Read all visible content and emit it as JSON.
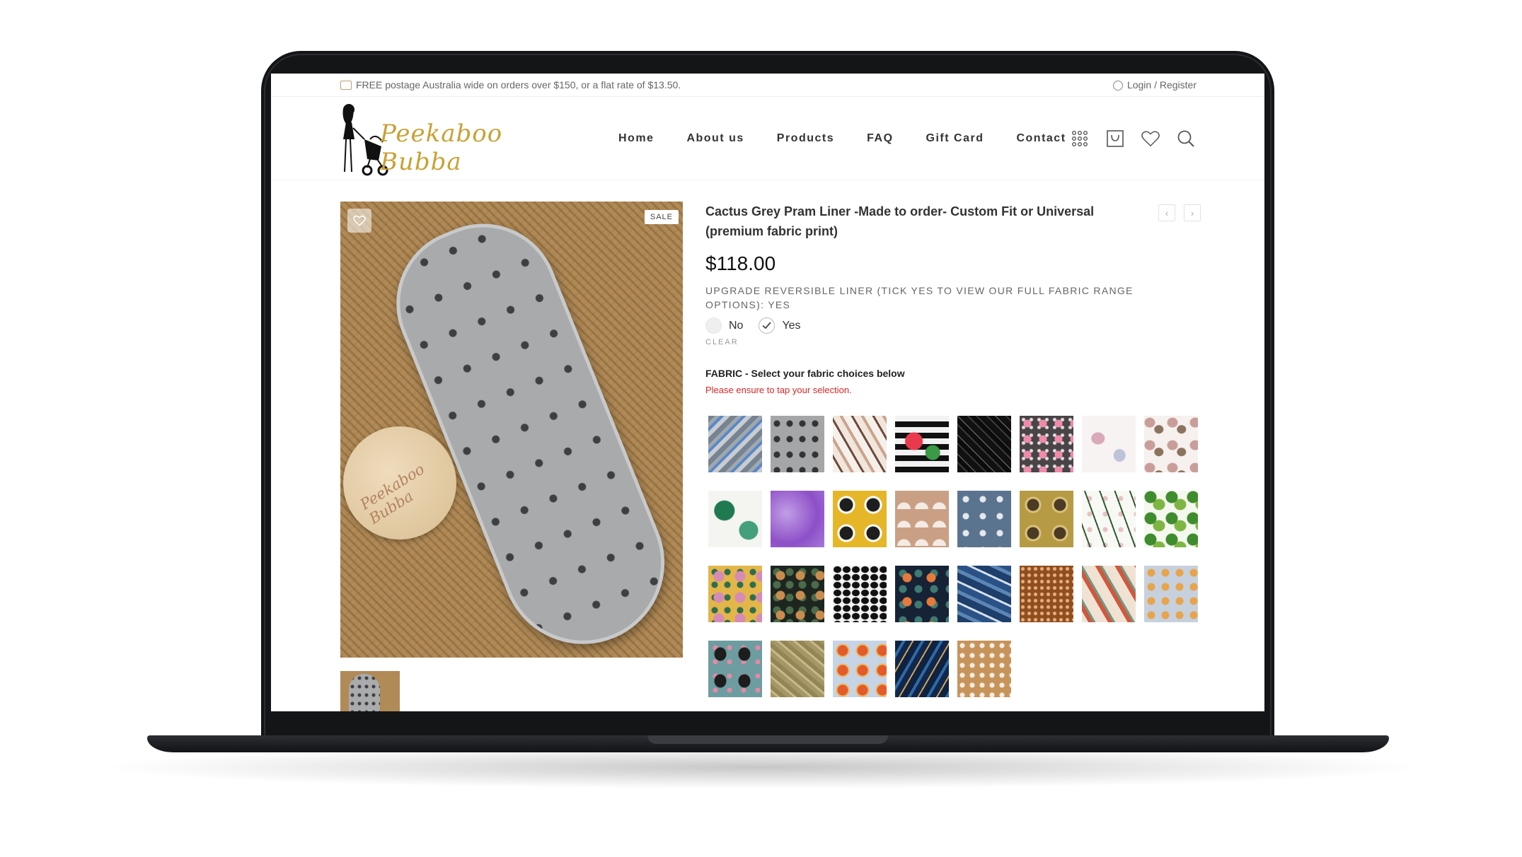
{
  "topbar": {
    "promo_text": "FREE postage Australia wide on orders over $150, or a flat rate of $13.50.",
    "account_text": "Login / Register"
  },
  "brand": {
    "logo_text": "Peekaboo Bubba",
    "gold_color": "#c9a134"
  },
  "nav": {
    "items": [
      {
        "label": "Home"
      },
      {
        "label": "About us"
      },
      {
        "label": "Products"
      },
      {
        "label": "FAQ"
      },
      {
        "label": "Gift Card"
      },
      {
        "label": "Contact"
      }
    ]
  },
  "header_icons": [
    "grid-icon",
    "cart-icon",
    "heart-icon",
    "search-icon"
  ],
  "product": {
    "badge": "SALE",
    "title": "Cactus Grey Pram Liner -Made to order- Custom Fit or Universal (premium fabric print)",
    "price": "$118.00",
    "option_label": "UPGRADE REVERSIBLE LINER (TICK YES TO VIEW OUR FULL FABRIC RANGE OPTIONS): YES",
    "options": [
      {
        "label": "No",
        "selected": false
      },
      {
        "label": "Yes",
        "selected": true
      }
    ],
    "clear_label": "CLEAR",
    "image_tag_text": "Peekaboo Bubba"
  },
  "fabric": {
    "title": "FABRIC - Select your fabric choices below",
    "note": "Please ensure to tap your selection.",
    "note_color": "#e02424",
    "swatch_count": 29
  },
  "nav_arrows": {
    "prev": "‹",
    "next": "›"
  }
}
